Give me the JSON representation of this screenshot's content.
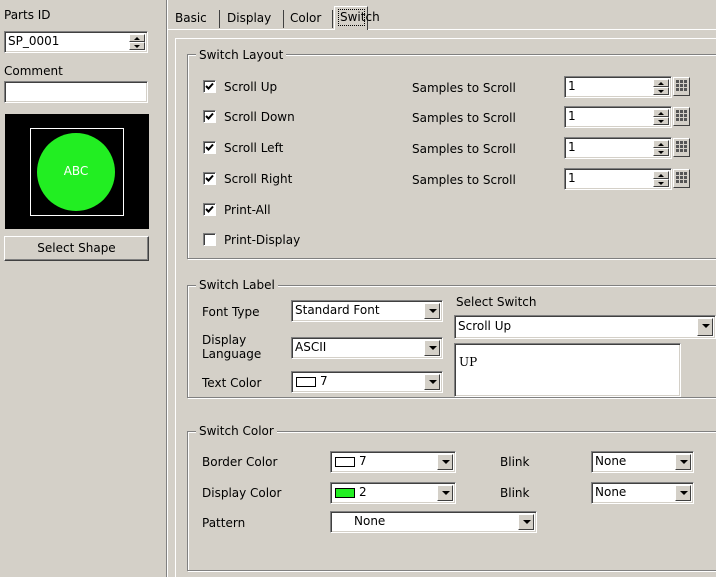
{
  "left_panel": {
    "parts_id_label": "Parts ID",
    "parts_id_value": "SP_0001",
    "comment_label": "Comment",
    "comment_value": "",
    "preview_text": "ABC",
    "select_shape_label": "Select Shape"
  },
  "tabs": [
    {
      "label": "Basic",
      "active": false
    },
    {
      "label": "Display",
      "active": false
    },
    {
      "label": "Color",
      "active": false
    },
    {
      "label": "Switch",
      "active": true
    }
  ],
  "switch_layout": {
    "title": "Switch Layout",
    "samples_label": "Samples to Scroll",
    "items": [
      {
        "label": "Scroll Up",
        "checked": true,
        "samples": "1"
      },
      {
        "label": "Scroll Down",
        "checked": true,
        "samples": "1"
      },
      {
        "label": "Scroll Left",
        "checked": true,
        "samples": "1"
      },
      {
        "label": "Scroll Right",
        "checked": true,
        "samples": "1"
      },
      {
        "label": "Print-All",
        "checked": true
      },
      {
        "label": "Print-Display",
        "checked": false
      }
    ]
  },
  "switch_label": {
    "title": "Switch Label",
    "font_type_label": "Font Type",
    "font_type_value": "Standard Font",
    "display_language_label_1": "Display",
    "display_language_label_2": "Language",
    "display_language_value": "ASCII",
    "text_color_label": "Text Color",
    "text_color_value": "7",
    "select_switch_label": "Select Switch",
    "select_switch_value": "Scroll Up",
    "label_text": "UP"
  },
  "switch_color": {
    "title": "Switch Color",
    "border_color_label": "Border Color",
    "border_color_value": "7",
    "display_color_label": "Display Color",
    "display_color_value": "2",
    "blink_label": "Blink",
    "blink_1_value": "None",
    "blink_2_value": "None",
    "pattern_label": "Pattern",
    "pattern_value": "None"
  },
  "colors": {
    "window_bg": "#d4d0c8",
    "preview_bg": "#000000",
    "preview_circle": "#22ee22",
    "swatch_white": "#ffffff",
    "swatch_green": "#22ee22"
  }
}
